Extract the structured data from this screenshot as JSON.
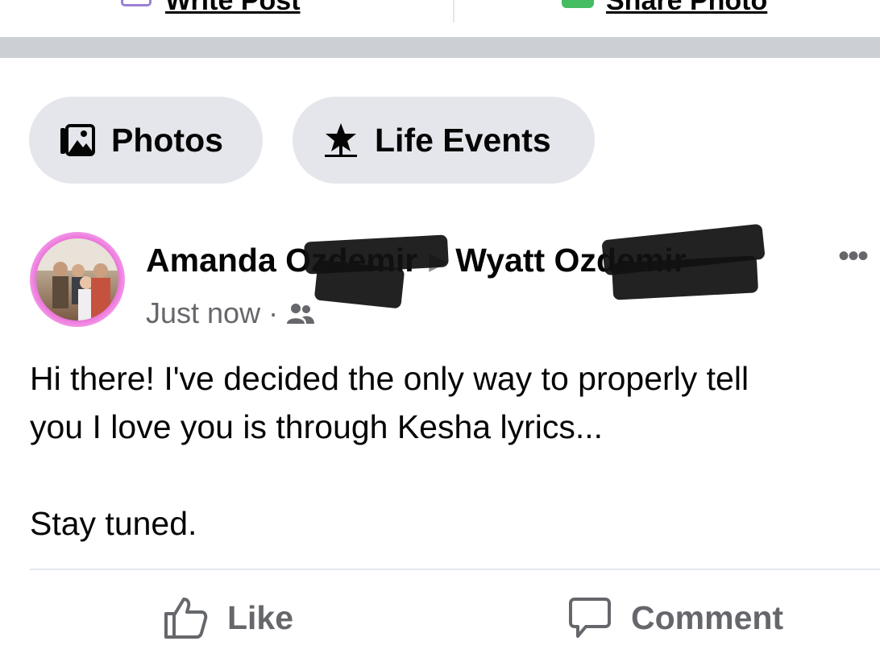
{
  "top_bar": {
    "write_post_label": "Write Post",
    "share_photo_label": "Share Photo"
  },
  "chips": [
    {
      "label": "Photos",
      "icon": "photos-icon"
    },
    {
      "label": "Life Events",
      "icon": "star-flag-icon"
    }
  ],
  "post": {
    "author": "Amanda O",
    "author_obscured_suffix": "zdemir",
    "recipient": "Wyatt O",
    "recipient_obscured_suffix": "zdemir",
    "timestamp": "Just now",
    "audience_icon": "friends-icon",
    "text_lines": [
      "Hi there! I've decided the only way to properly tell",
      "you I love you is through Kesha lyrics..."
    ],
    "text_after_break": "Stay tuned.",
    "more_icon": "more-dots-icon"
  },
  "actions": {
    "like_label": "Like",
    "comment_label": "Comment"
  },
  "colors": {
    "chip_bg": "#e4e6eb",
    "separator": "#ccd0d5",
    "secondary_text": "#65676b",
    "primary_text": "#050505"
  }
}
